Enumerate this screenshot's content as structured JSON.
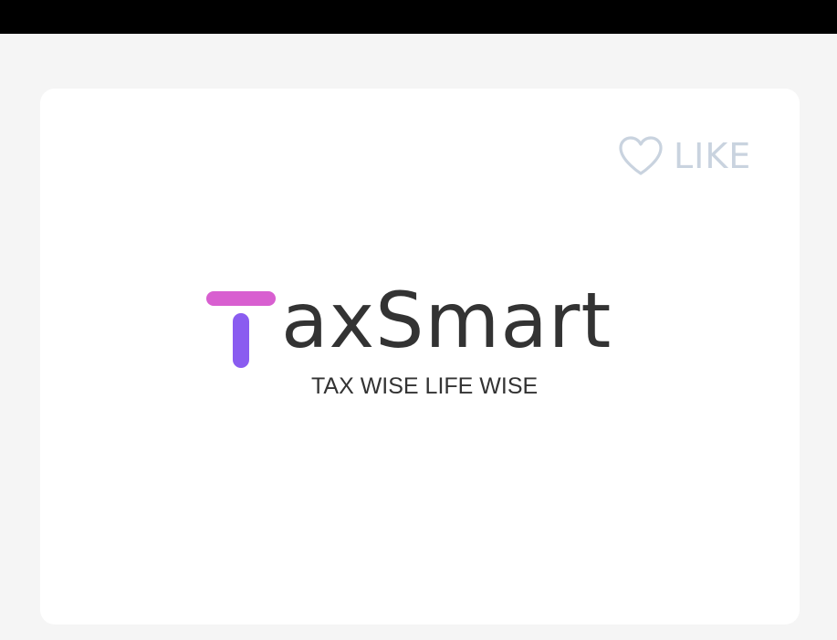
{
  "like": {
    "icon": "heart-outline-icon",
    "label": "LIKE",
    "color": "#c9d3df"
  },
  "logo": {
    "wordmark": "axSmart",
    "tagline": "TAX WISE LIFE WISE",
    "t_bar_color": "#d85fd0",
    "t_stem_color": "#8a5cf0",
    "text_color": "#333333"
  },
  "colors": {
    "background": "#f5f5f5",
    "card": "#ffffff",
    "status_bar": "#000000"
  }
}
